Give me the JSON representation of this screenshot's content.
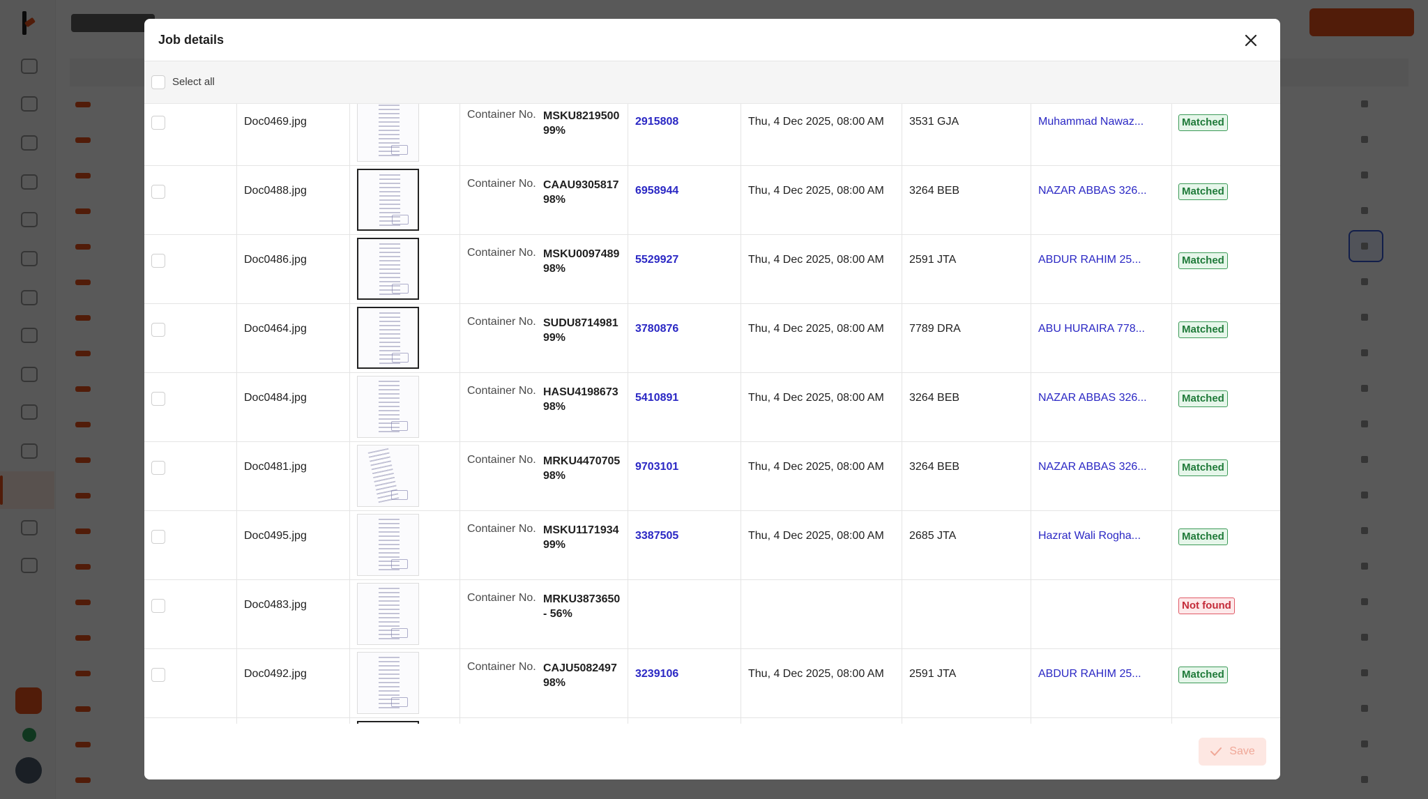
{
  "modal": {
    "title": "Job details",
    "select_all_label": "Select all",
    "save_label": "Save"
  },
  "colors": {
    "accent": "#e8501c",
    "link": "#2a27c4",
    "matched": "#3c9a57",
    "not_found": "#e05a66"
  },
  "rows": [
    {
      "file": "Doc0469.jpg",
      "container_label": "Container No.",
      "container_value": "MSKU8219500\n99%",
      "job": "2915808",
      "date": "Thu, 4 Dec 2025, 08:00 AM",
      "plate": "3531 GJA",
      "driver": "Muhammad Nawaz...",
      "status": "Matched"
    },
    {
      "file": "Doc0488.jpg",
      "container_label": "Container No.",
      "container_value": "CAAU9305817\n98%",
      "job": "6958944",
      "date": "Thu, 4 Dec 2025, 08:00 AM",
      "plate": "3264 BEB",
      "driver": "NAZAR ABBAS 326...",
      "status": "Matched"
    },
    {
      "file": "Doc0486.jpg",
      "container_label": "Container No.",
      "container_value": "MSKU0097489\n98%",
      "job": "5529927",
      "date": "Thu, 4 Dec 2025, 08:00 AM",
      "plate": "2591 JTA",
      "driver": "ABDUR RAHIM 25...",
      "status": "Matched"
    },
    {
      "file": "Doc0464.jpg",
      "container_label": "Container No.",
      "container_value": "SUDU8714981\n99%",
      "job": "3780876",
      "date": "Thu, 4 Dec 2025, 08:00 AM",
      "plate": "7789 DRA",
      "driver": "ABU HURAIRA 778...",
      "status": "Matched"
    },
    {
      "file": "Doc0484.jpg",
      "container_label": "Container No.",
      "container_value": "HASU4198673\n98%",
      "job": "5410891",
      "date": "Thu, 4 Dec 2025, 08:00 AM",
      "plate": "3264 BEB",
      "driver": "NAZAR ABBAS 326...",
      "status": "Matched"
    },
    {
      "file": "Doc0481.jpg",
      "container_label": "Container No.",
      "container_value": "MRKU4470705\n98%",
      "job": "9703101",
      "date": "Thu, 4 Dec 2025, 08:00 AM",
      "plate": "3264 BEB",
      "driver": "NAZAR ABBAS 326...",
      "status": "Matched"
    },
    {
      "file": "Doc0495.jpg",
      "container_label": "Container No.",
      "container_value": "MSKU1171934\n99%",
      "job": "3387505",
      "date": "Thu, 4 Dec 2025, 08:00 AM",
      "plate": "2685 JTA",
      "driver": "Hazrat Wali Rogha...",
      "status": "Matched"
    },
    {
      "file": "Doc0483.jpg",
      "container_label": "Container No.",
      "container_value": "MRKU3873650\n- 56%",
      "job": "",
      "date": "",
      "plate": "",
      "driver": "",
      "status": "Not found"
    },
    {
      "file": "Doc0492.jpg",
      "container_label": "Container No.",
      "container_value": "CAJU5082497\n98%",
      "job": "3239106",
      "date": "Thu, 4 Dec 2025, 08:00 AM",
      "plate": "2591 JTA",
      "driver": "ABDUR RAHIM 25...",
      "status": "Matched"
    }
  ]
}
